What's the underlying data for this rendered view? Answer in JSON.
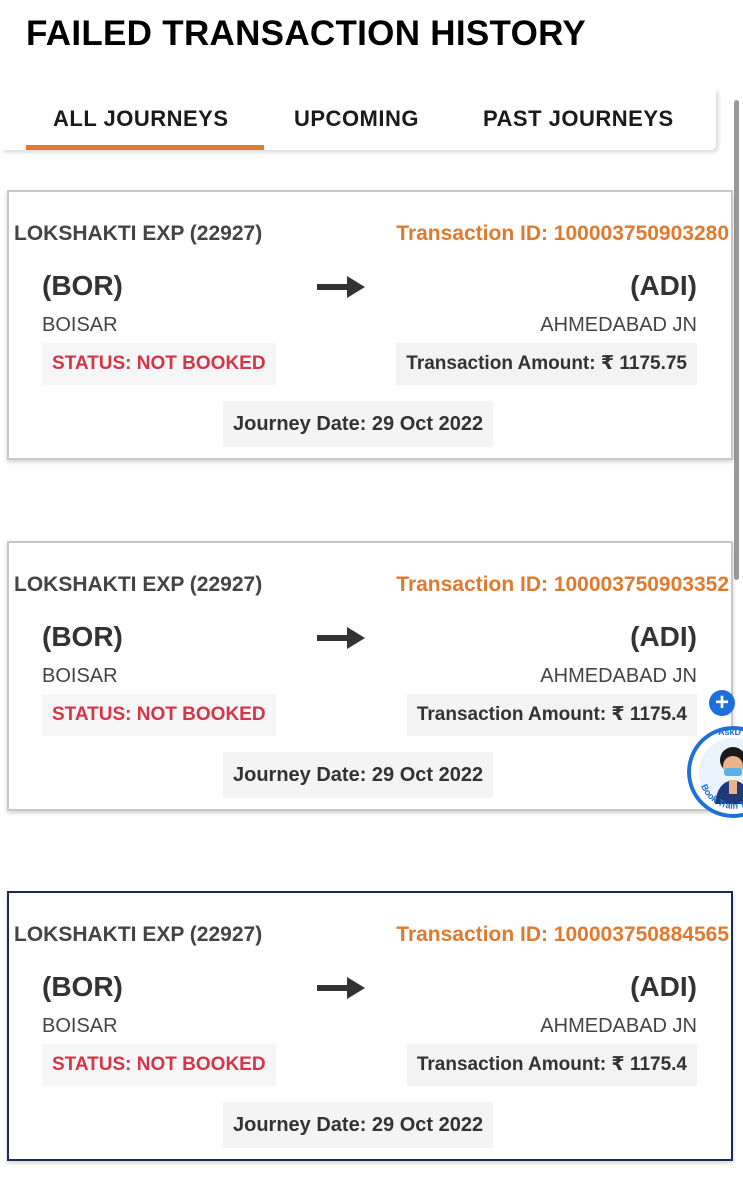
{
  "page": {
    "title": "FAILED TRANSACTION HISTORY"
  },
  "tabs": [
    {
      "label": "ALL JOURNEYS",
      "active": true
    },
    {
      "label": "UPCOMING",
      "active": false
    },
    {
      "label": "PAST JOURNEYS",
      "active": false
    }
  ],
  "colors": {
    "accent": "#e07a2e",
    "status": "#d63447",
    "selected_border": "#1c2a56"
  },
  "transactions": [
    {
      "train": "LOKSHAKTI EXP (22927)",
      "transaction_id": "Transaction ID: 100003750903280",
      "from_code": "(BOR)",
      "from_name": "BOISAR",
      "to_code": "(ADI)",
      "to_name": "AHMEDABAD JN",
      "status": "STATUS: NOT BOOKED",
      "amount": "Transaction Amount: ₹ 1175.75",
      "journey_date": "Journey Date: 29 Oct 2022"
    },
    {
      "train": "LOKSHAKTI EXP (22927)",
      "transaction_id": "Transaction ID: 100003750903352",
      "from_code": "(BOR)",
      "from_name": "BOISAR",
      "to_code": "(ADI)",
      "to_name": "AHMEDABAD JN",
      "status": "STATUS: NOT BOOKED",
      "amount": "Transaction Amount: ₹ 1175.4",
      "journey_date": "Journey Date: 29 Oct 2022"
    },
    {
      "train": "LOKSHAKTI EXP (22927)",
      "transaction_id": "Transaction ID: 100003750884565",
      "from_code": "(BOR)",
      "from_name": "BOISAR",
      "to_code": "(ADI)",
      "to_name": "AHMEDABAD JN",
      "status": "STATUS: NOT BOOKED",
      "amount": "Transaction Amount: ₹ 1175.4",
      "journey_date": "Journey Date: 29 Oct 2022"
    }
  ],
  "widgets": {
    "plus_icon": "plus-icon",
    "assistant_label": "AskD",
    "assistant_tagline": "Book Train Ticket"
  }
}
